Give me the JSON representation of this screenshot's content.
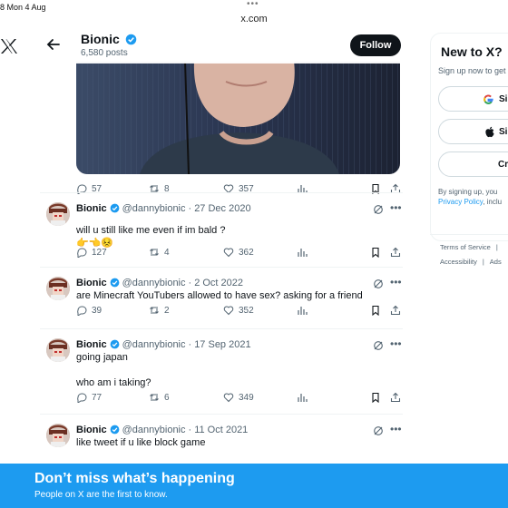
{
  "status_bar": {
    "time": "8  Mon 4 Aug",
    "dots": "•••"
  },
  "browser": {
    "url": "x.com"
  },
  "header": {
    "name": "Bionic",
    "posts": "6,580 posts",
    "follow_label": "Follow"
  },
  "media_actions": {
    "replies": "57",
    "reposts": "8",
    "likes": "357"
  },
  "tweets": [
    {
      "name": "Bionic",
      "handle": "@dannybionic",
      "date": "27 Dec 2020",
      "text": "will u still like me even if im bald ?\n👉👈😣",
      "replies": "127",
      "reposts": "4",
      "likes": "362"
    },
    {
      "name": "Bionic",
      "handle": "@dannybionic",
      "date": "2 Oct 2022",
      "text": "are Minecraft YouTubers allowed to have sex? asking for a friend",
      "replies": "39",
      "reposts": "2",
      "likes": "352"
    },
    {
      "name": "Bionic",
      "handle": "@dannybionic",
      "date": "17 Sep 2021",
      "text": "going japan\n\nwho am i taking?",
      "replies": "77",
      "reposts": "6",
      "likes": "349"
    },
    {
      "name": "Bionic",
      "handle": "@dannybionic",
      "date": "11 Oct 2021",
      "text": "like tweet if u like block game"
    }
  ],
  "sidebar": {
    "title": "New to X?",
    "subtitle": "Sign up now to get",
    "google_label": "Si",
    "apple_label": "Si",
    "create_label": "Cr",
    "legal_line1": "By signing up, you",
    "legal_privacy": "Privacy Policy",
    "legal_line2": ", inclu",
    "footer_row1": [
      "Terms of Service",
      "|"
    ],
    "footer_row2": [
      "Accessibility",
      "|",
      "Ads"
    ]
  },
  "banner": {
    "title": "Don’t miss what’s happening",
    "subtitle": "People on X are the first to know."
  },
  "colors": {
    "accent": "#1d9bf0",
    "text": "#0f1419",
    "muted": "#536471"
  },
  "icons": [
    "x-logo-icon",
    "back-arrow-icon",
    "verified-icon",
    "reply-icon",
    "repost-icon",
    "like-icon",
    "views-icon",
    "bookmark-icon",
    "share-icon",
    "grok-icon",
    "more-icon",
    "google-icon",
    "apple-icon"
  ]
}
